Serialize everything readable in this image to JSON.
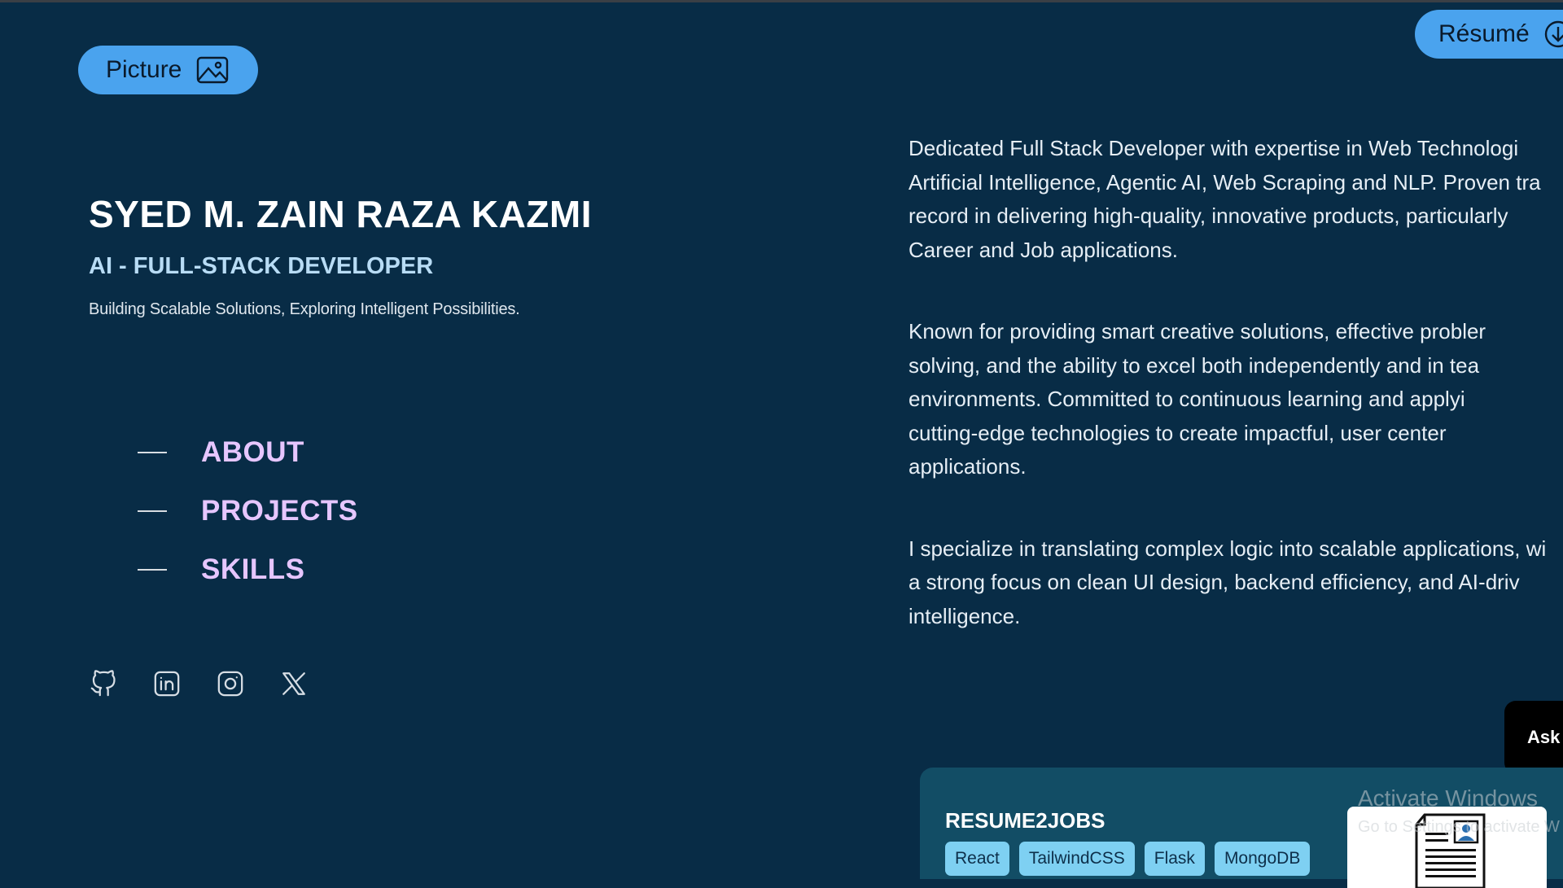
{
  "header": {
    "picture_label": "Picture",
    "resume_label": "Résumé"
  },
  "hero": {
    "name": "SYED M. ZAIN RAZA KAZMI",
    "role": "AI - FULL-STACK DEVELOPER",
    "tagline": "Building Scalable Solutions, Exploring Intelligent Possibilities."
  },
  "nav": {
    "items": [
      {
        "label": "ABOUT"
      },
      {
        "label": "PROJECTS"
      },
      {
        "label": "SKILLS"
      }
    ]
  },
  "socials": [
    "github-icon",
    "linkedin-icon",
    "instagram-icon",
    "x-icon"
  ],
  "about": {
    "paragraphs": [
      "Dedicated Full Stack Developer with expertise in Web Technologi",
      "Artificial Intelligence, Agentic AI, Web Scraping and NLP. Proven tra",
      "record in delivering high-quality, innovative products, particularly",
      "Career and Job applications.",
      "Known for providing smart creative solutions, effective probler",
      "solving, and the ability to excel both independently and in tea",
      "environments. Committed to continuous learning and applyi",
      "cutting-edge technologies to create impactful, user center",
      "applications.",
      "I specialize in translating complex logic into scalable applications, wi",
      "a strong focus on clean UI design, backend efficiency, and AI-driv",
      "intelligence."
    ]
  },
  "ask_button": {
    "label": "Ask"
  },
  "project_card": {
    "title": "RESUME2JOBS",
    "tags": [
      "React",
      "TailwindCSS",
      "Flask",
      "MongoDB"
    ]
  },
  "watermark": {
    "title": "Activate Windows",
    "subtitle": "Go to Settings to activate W"
  },
  "colors": {
    "background": "#082c46",
    "accent": "#4aa3ee",
    "nav_label": "#e6c6ff",
    "card": "#124d65",
    "tag": "#7ed0f2"
  }
}
